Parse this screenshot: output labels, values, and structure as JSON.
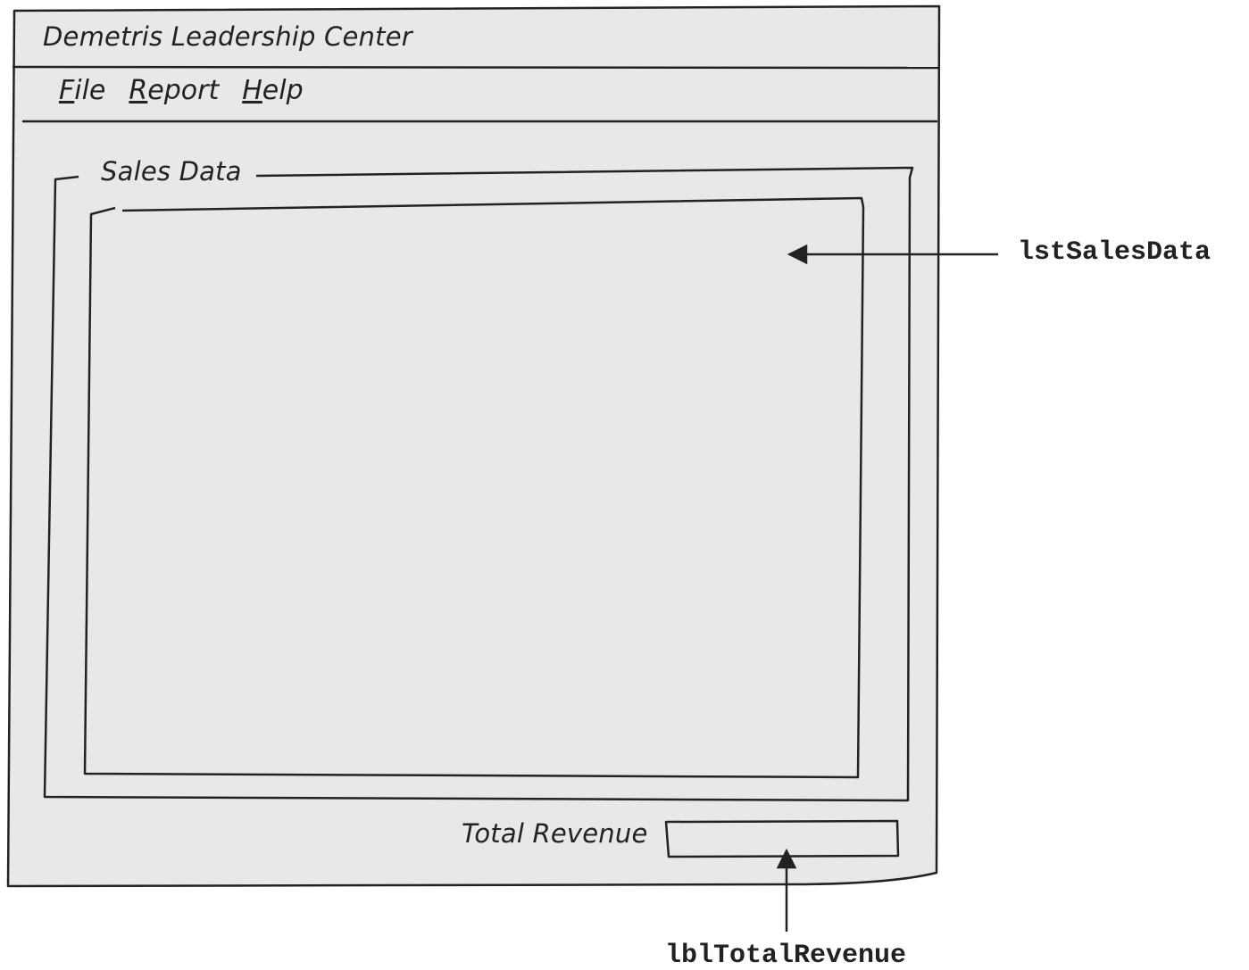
{
  "window": {
    "title": "Demetris Leadership Center"
  },
  "menu": [
    {
      "mnemonic": "F",
      "rest": "ile"
    },
    {
      "mnemonic": "R",
      "rest": "eport"
    },
    {
      "mnemonic": "H",
      "rest": "elp"
    }
  ],
  "group_box": {
    "caption": "Sales Data"
  },
  "total": {
    "label": "Total Revenue"
  },
  "annotations": {
    "list_box": "lstSalesData",
    "total_label": "lblTotalRevenue"
  },
  "colors": {
    "window_fill": "#e8e8e8",
    "stroke": "#222222"
  }
}
